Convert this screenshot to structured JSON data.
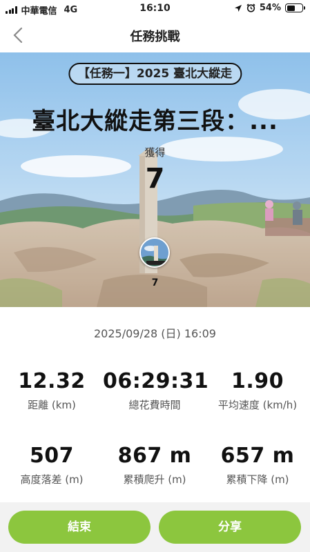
{
  "status_bar": {
    "carrier": "中華電信",
    "network": "4G",
    "time": "16:10",
    "battery_percent": "54%",
    "battery_level": 0.54,
    "icons": [
      "signal-icon",
      "location-arrow-icon",
      "alarm-icon",
      "battery-icon"
    ]
  },
  "nav": {
    "back_icon": "chevron-left-icon",
    "title": "任務挑戰"
  },
  "hero": {
    "mission_pill": "【任務一】2025 臺北大縱走",
    "title": "臺北大縱走第三段：...",
    "earn_label": "獲得",
    "earn_value": "7",
    "badge_icon": "summit-marker-badge-icon",
    "badge_count": "7"
  },
  "stats": {
    "datetime": "2025/09/28 (日) 16:09",
    "items": [
      {
        "value": "12.32",
        "label": "距離 (km)"
      },
      {
        "value": "06:29:31",
        "label": "總花費時間"
      },
      {
        "value": "1.90",
        "label": "平均速度 (km/h)"
      },
      {
        "value": "507",
        "label": "高度落差 (m)"
      },
      {
        "value": "867 m",
        "label": "累積爬升 (m)"
      },
      {
        "value": "657 m",
        "label": "累積下降 (m)"
      }
    ]
  },
  "buttons": {
    "end": "結束",
    "share": "分享"
  },
  "colors": {
    "accent_green": "#8cc63e",
    "sky": "#9cc8ec",
    "text_dark": "#111111"
  }
}
